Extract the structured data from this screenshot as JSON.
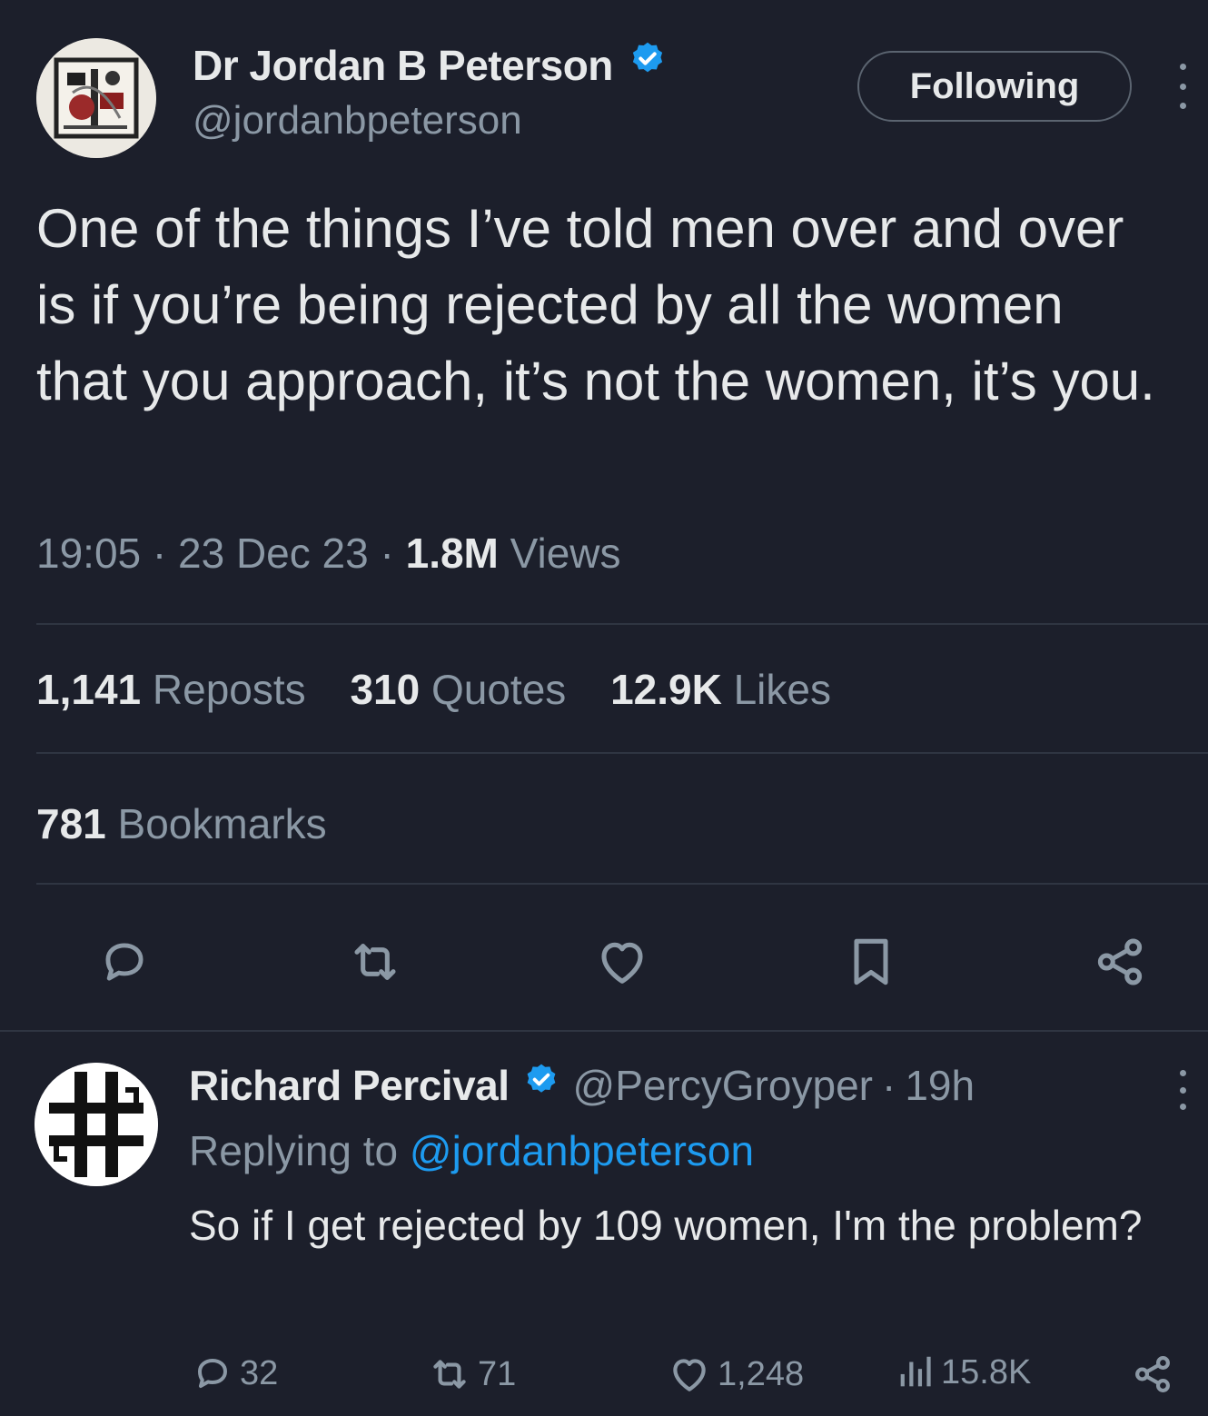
{
  "main_tweet": {
    "author": {
      "name": "Dr Jordan B Peterson",
      "handle": "@jordanbpeterson",
      "verified": true,
      "avatar_icon": "avatar-crest-icon"
    },
    "follow_button_label": "Following",
    "more_icon": "more-vertical-icon",
    "text": "One of the things I’ve told men over and over is if you’re being rejected by all the women that you approach, it’s not the women, it’s you.",
    "time": "19:05",
    "date": "23 Dec 23",
    "views_count": "1.8M",
    "views_label": "Views",
    "separator": "·",
    "stats": {
      "reposts_count": "1,141",
      "reposts_label": "Reposts",
      "quotes_count": "310",
      "quotes_label": "Quotes",
      "likes_count": "12.9K",
      "likes_label": "Likes",
      "bookmarks_count": "781",
      "bookmarks_label": "Bookmarks"
    },
    "actions": [
      "reply-icon",
      "repost-icon",
      "like-icon",
      "bookmark-icon",
      "share-icon"
    ]
  },
  "reply_tweet": {
    "author": {
      "name": "Richard Percival",
      "handle": "@PercyGroyper",
      "verified": true,
      "avatar_icon": "avatar-emblem-icon"
    },
    "time": "19h",
    "separator": "·",
    "replying_prefix": "Replying to",
    "replying_to": "@jordanbpeterson",
    "text": "So if I get rejected by 109 women, I'm the problem?",
    "actions": {
      "replies": "32",
      "reposts": "71",
      "likes": "1,248",
      "views": "15.8K"
    }
  },
  "colors": {
    "background": "#1c1f2b",
    "text_primary": "#e7e9ea",
    "text_secondary": "#8b98a5",
    "link": "#1d9bf0",
    "verified_badge": "#1d9bf0",
    "divider": "#2f3542"
  }
}
